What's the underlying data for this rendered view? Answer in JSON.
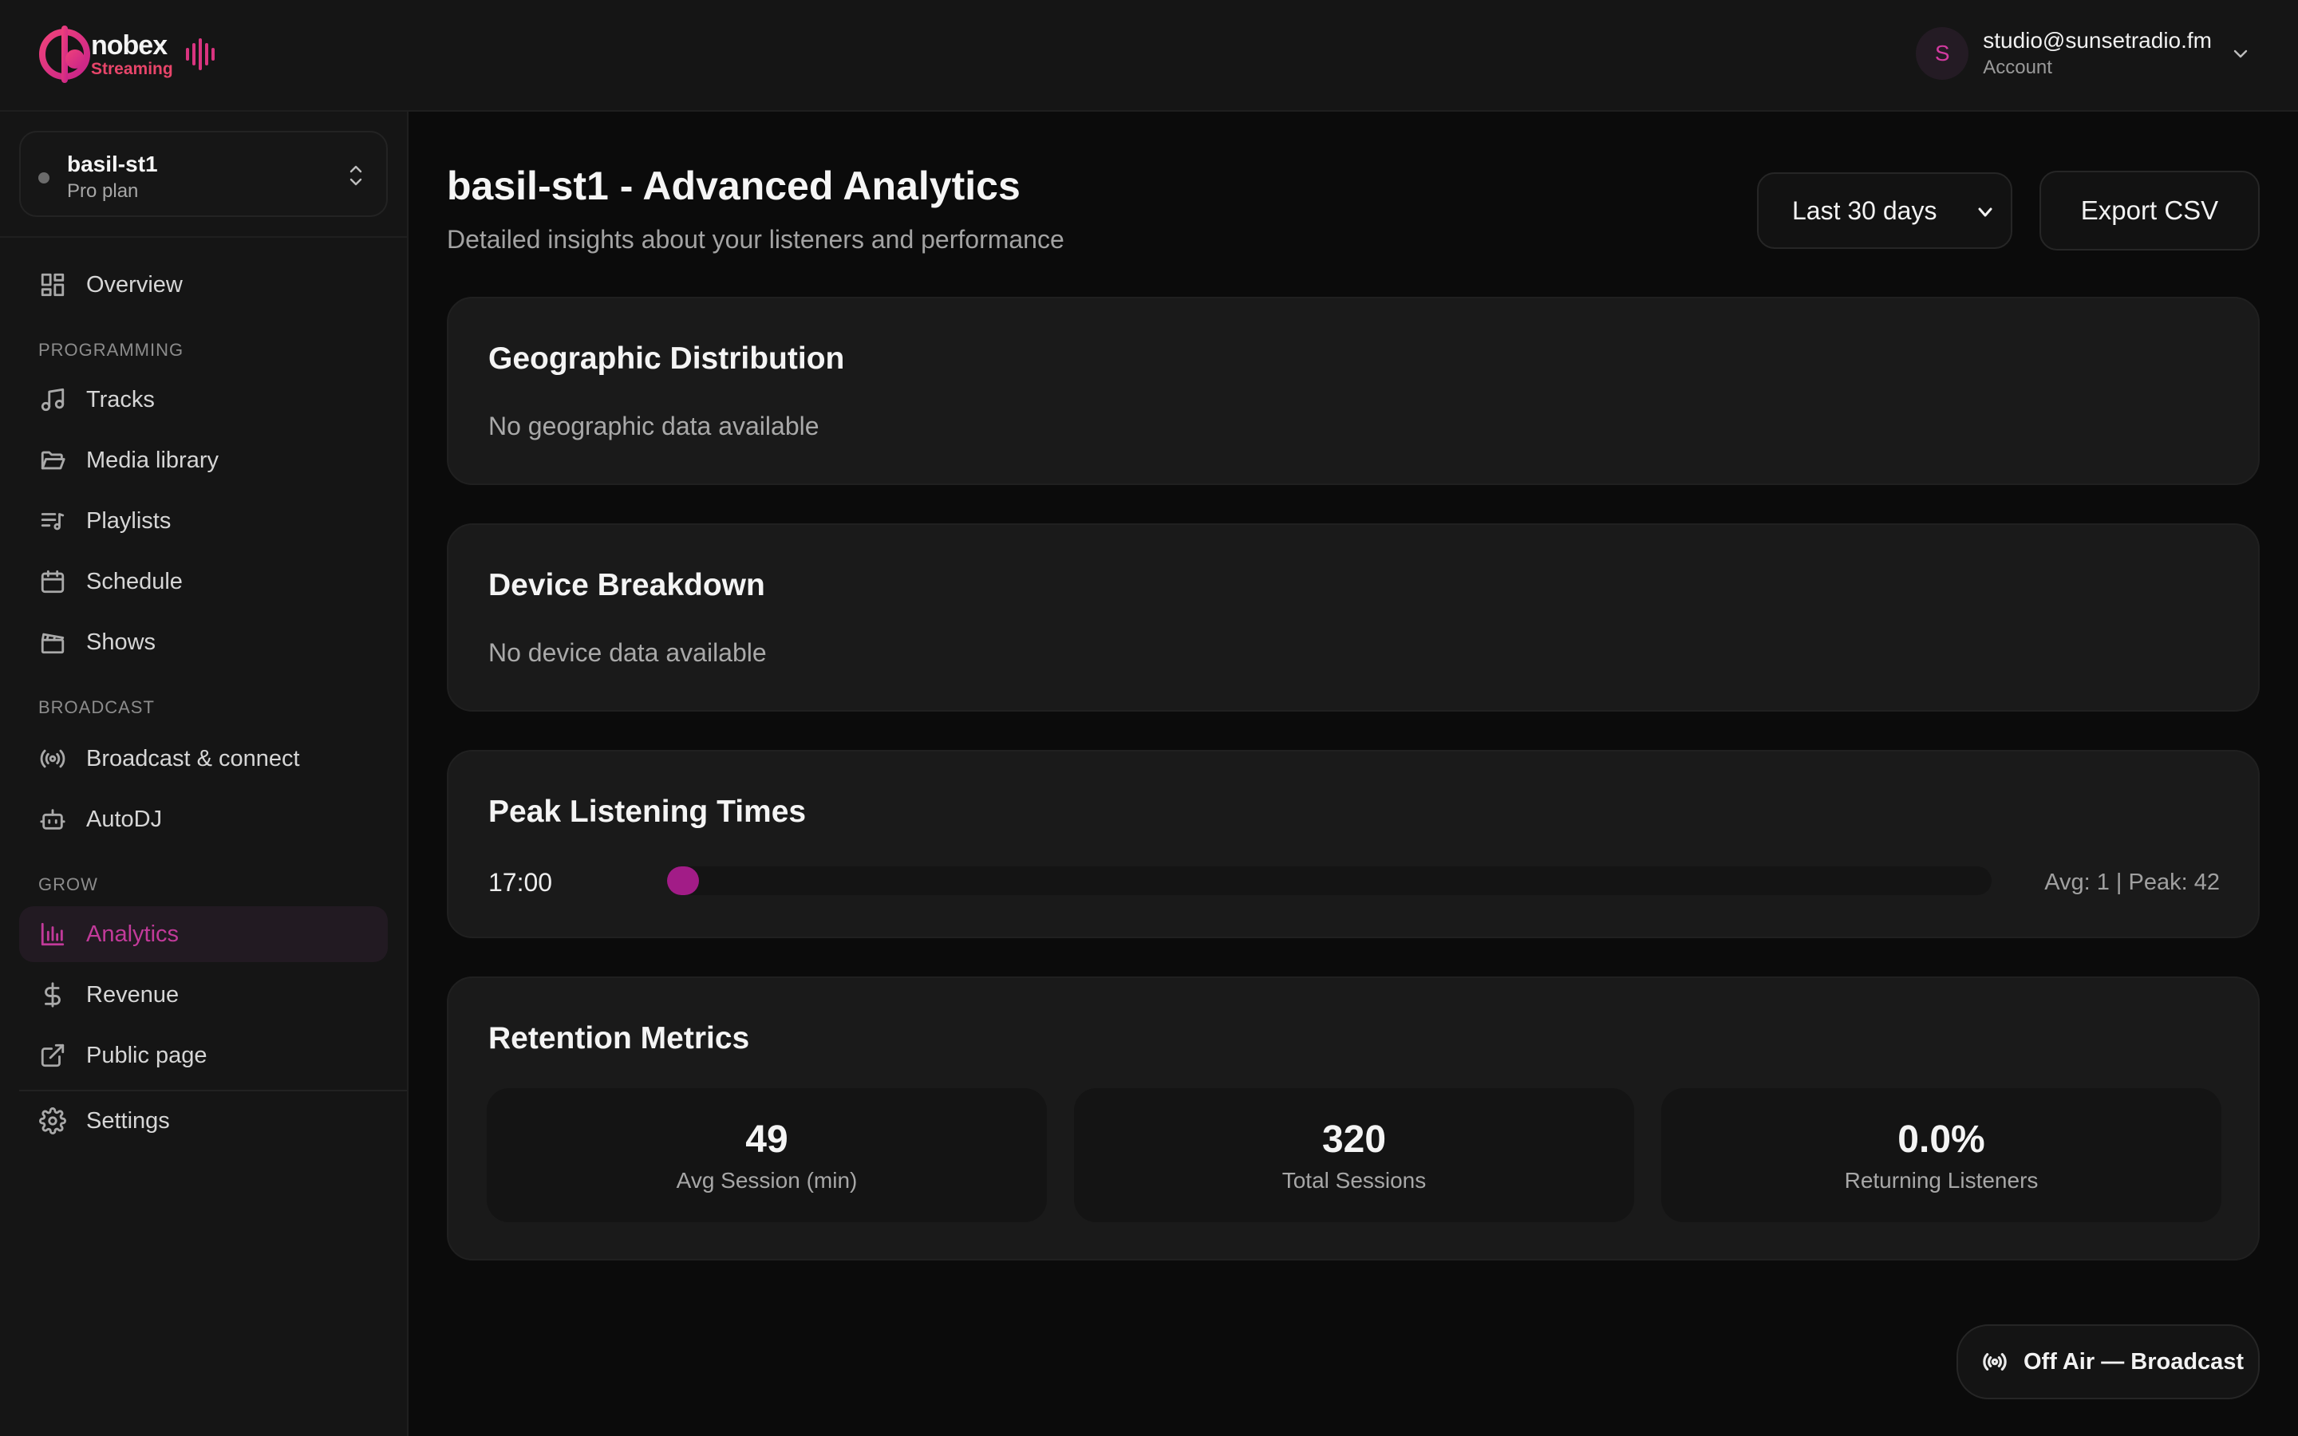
{
  "brand": {
    "line1": "nobex",
    "line2": "Streaming"
  },
  "account": {
    "initial": "S",
    "email": "studio@sunsetradio.fm",
    "label": "Account"
  },
  "station": {
    "name": "basil-st1",
    "plan": "Pro plan"
  },
  "sidebar": {
    "overview": "Overview",
    "sections": {
      "programming": "PROGRAMMING",
      "broadcast": "BROADCAST",
      "grow": "GROW"
    },
    "items": {
      "tracks": "Tracks",
      "media_library": "Media library",
      "playlists": "Playlists",
      "schedule": "Schedule",
      "shows": "Shows",
      "broadcast_connect": "Broadcast & connect",
      "autodj": "AutoDJ",
      "analytics": "Analytics",
      "revenue": "Revenue",
      "public_page": "Public page",
      "settings": "Settings"
    },
    "active": "analytics"
  },
  "header": {
    "title": "basil-st1 - Advanced Analytics",
    "subtitle": "Detailed insights about your listeners and performance",
    "range_selected": "Last 30 days",
    "export_label": "Export CSV"
  },
  "geo": {
    "title": "Geographic Distribution",
    "empty": "No geographic data available"
  },
  "devices": {
    "title": "Device Breakdown",
    "empty": "No device data available"
  },
  "peak": {
    "title": "Peak Listening Times",
    "rows": [
      {
        "time": "17:00",
        "avg": 1,
        "peak": 42,
        "stats": "Avg: 1 | Peak: 42"
      }
    ]
  },
  "retention": {
    "title": "Retention Metrics",
    "metrics": [
      {
        "value": "49",
        "label": "Avg Session (min)"
      },
      {
        "value": "320",
        "label": "Total Sessions"
      },
      {
        "value": "0.0%",
        "label": "Returning Listeners"
      }
    ]
  },
  "broadcast_button": {
    "label": "Off Air — Broadcast"
  },
  "colors": {
    "accent": "#c23a9a",
    "bar": "#a21c87",
    "logo_pink": "#e8456a",
    "background": "#0b0b0b",
    "card": "#1a1a1a"
  }
}
